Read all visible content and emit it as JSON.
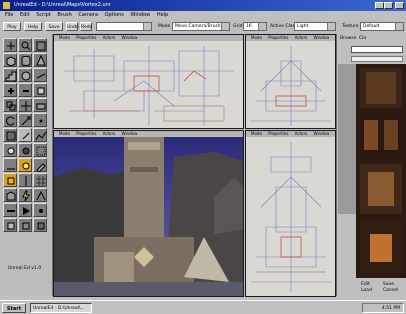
{
  "window": {
    "title": "UnrealEd - D:\\Unreal\\Maps\\Vortex2.unr"
  },
  "menu": [
    "File",
    "Edit",
    "Script",
    "Brush",
    "Camera",
    "Options",
    "Window",
    "Help"
  ],
  "toolbar": {
    "buttons": [
      "Play",
      "Help",
      "Save",
      "Undo",
      "Redo"
    ],
    "mode_label": "Mode",
    "mode_value": "Move Camera/Brush",
    "grid_label": "Grid",
    "grid_value": "16",
    "active_label": "Active Class",
    "active_value": "Light",
    "texture_label": "Texture",
    "texture_value": "Default"
  },
  "viewport_menu": [
    "Mode",
    "Properties",
    "Actors",
    "Window"
  ],
  "right_panel": {
    "tabs": [
      "Browse",
      "Cla"
    ],
    "buttons": [
      "Edit",
      "Load",
      "Save",
      "Cancel"
    ]
  },
  "status": {
    "left_text": "Unreal Ed v1.0"
  },
  "taskbar": {
    "start_label": "Start",
    "task_item": "UnrealEd - D:\\Unreal\\...",
    "clock": "4:51 PM"
  },
  "colors": {
    "title_start": "#0a1f8a",
    "title_end": "#3a6ad0",
    "wire_bg": "#d9d8d2",
    "render_sky": "#3a3a8a",
    "selected_tool": "#d8a020"
  }
}
